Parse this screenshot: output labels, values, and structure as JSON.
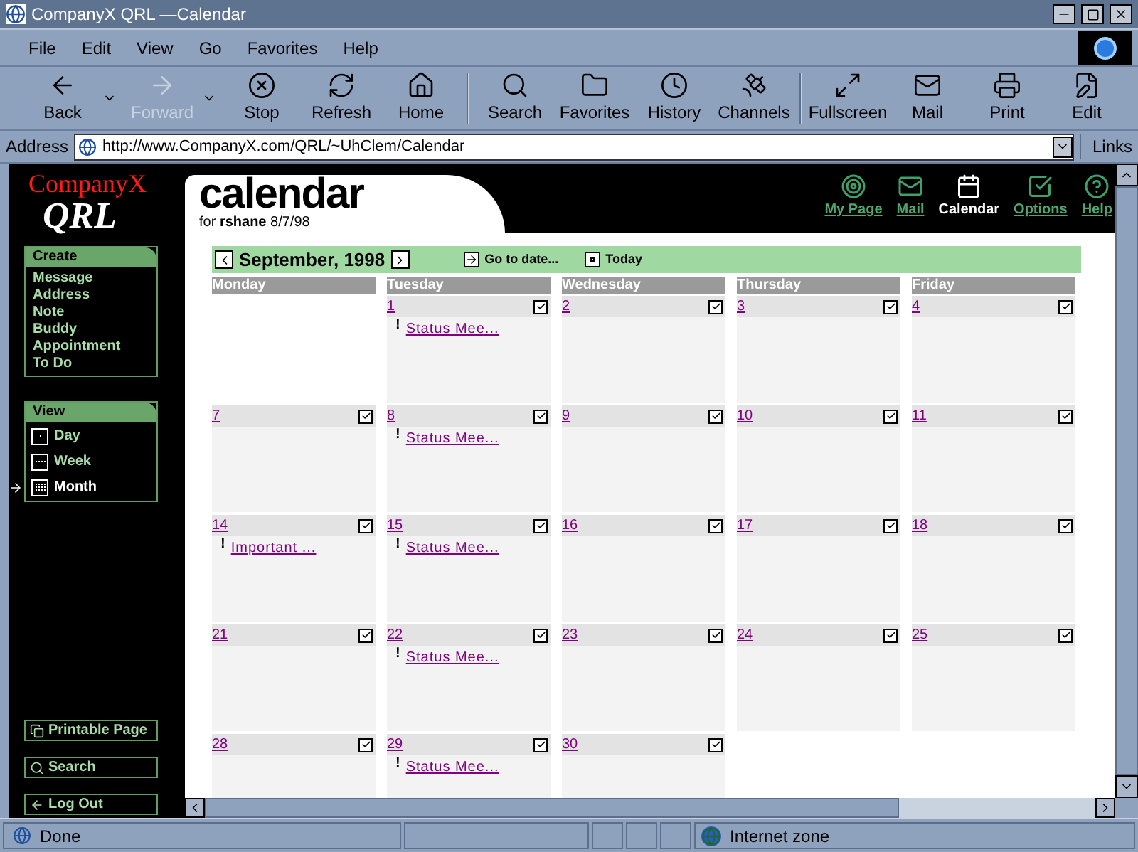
{
  "window": {
    "title": "CompanyX QRL —Calendar"
  },
  "menu": [
    "File",
    "Edit",
    "View",
    "Go",
    "Favorites",
    "Help"
  ],
  "toolbar": [
    {
      "kind": "back",
      "label": "Back",
      "disabled": false,
      "dropdown": true
    },
    {
      "kind": "forward",
      "label": "Forward",
      "disabled": true,
      "dropdown": true
    },
    {
      "kind": "stop",
      "label": "Stop",
      "disabled": false
    },
    {
      "kind": "refresh",
      "label": "Refresh",
      "disabled": false
    },
    {
      "kind": "home",
      "label": "Home",
      "disabled": false
    },
    {
      "kind": "search",
      "label": "Search",
      "disabled": false
    },
    {
      "kind": "favorites",
      "label": "Favorites",
      "disabled": false
    },
    {
      "kind": "history",
      "label": "History",
      "disabled": false
    },
    {
      "kind": "channels",
      "label": "Channels",
      "disabled": false
    },
    {
      "kind": "fullscreen",
      "label": "Fullscreen",
      "disabled": false
    },
    {
      "kind": "mail",
      "label": "Mail",
      "disabled": false
    },
    {
      "kind": "print",
      "label": "Print",
      "disabled": false
    },
    {
      "kind": "edit",
      "label": "Edit",
      "disabled": false
    }
  ],
  "address_bar": {
    "label": "Address",
    "url": "http://www.CompanyX.com/QRL/~UhClem/Calendar",
    "links": "Links"
  },
  "sidebar": {
    "logo": {
      "company": "CompanyX",
      "product": "QRL"
    },
    "create": {
      "title": "Create",
      "items": [
        "Message",
        "Address",
        "Note",
        "Buddy",
        "Appointment",
        "To Do"
      ]
    },
    "view": {
      "title": "View",
      "items": [
        {
          "kind": "day",
          "label": "Day",
          "selected": false
        },
        {
          "kind": "week",
          "label": "Week",
          "selected": false
        },
        {
          "kind": "month",
          "label": "Month",
          "selected": true
        }
      ]
    },
    "buttons": [
      {
        "kind": "print",
        "label": "Printable Page"
      },
      {
        "kind": "search",
        "label": "Search"
      },
      {
        "kind": "logout",
        "label": "Log Out"
      }
    ]
  },
  "header": {
    "title": "calendar",
    "subtitle": "for **rshane** 8/7/98",
    "nav": [
      {
        "kind": "mypage",
        "label": "My Page",
        "selected": false
      },
      {
        "kind": "mail",
        "label": "Mail",
        "selected": false
      },
      {
        "kind": "calendar",
        "label": "Calendar",
        "selected": true
      },
      {
        "kind": "options",
        "label": "Options",
        "selected": false
      },
      {
        "kind": "help",
        "label": "Help",
        "selected": false
      }
    ]
  },
  "calendar": {
    "month": "September, 1998",
    "go_to_date": "Go to date...",
    "today": "Today",
    "days": [
      "Monday",
      "Tuesday",
      "Wednesday",
      "Thursday",
      "Friday"
    ],
    "weeks": [
      [
        {
          "kind": "blank"
        },
        {
          "kind": "day",
          "day": "1",
          "events": [
            {
              "mark": "!",
              "text": "Status Mee..."
            }
          ]
        },
        {
          "kind": "day",
          "day": "2"
        },
        {
          "kind": "day",
          "day": "3"
        },
        {
          "kind": "day",
          "day": "4"
        }
      ],
      [
        {
          "kind": "day",
          "day": "7"
        },
        {
          "kind": "day",
          "day": "8",
          "events": [
            {
              "mark": "!",
              "text": "Status Mee..."
            }
          ]
        },
        {
          "kind": "day",
          "day": "9"
        },
        {
          "kind": "day",
          "day": "10"
        },
        {
          "kind": "day",
          "day": "11"
        }
      ],
      [
        {
          "kind": "day",
          "day": "14",
          "events": [
            {
              "mark": "!",
              "text": "Important ..."
            }
          ]
        },
        {
          "kind": "day",
          "day": "15",
          "events": [
            {
              "mark": "!",
              "text": "Status Mee..."
            }
          ]
        },
        {
          "kind": "day",
          "day": "16"
        },
        {
          "kind": "day",
          "day": "17"
        },
        {
          "kind": "day",
          "day": "18"
        }
      ],
      [
        {
          "kind": "day",
          "day": "21"
        },
        {
          "kind": "day",
          "day": "22",
          "events": [
            {
              "mark": "!",
              "text": "Status Mee..."
            }
          ]
        },
        {
          "kind": "day",
          "day": "23"
        },
        {
          "kind": "day",
          "day": "24"
        },
        {
          "kind": "day",
          "day": "25"
        }
      ],
      [
        {
          "kind": "day",
          "day": "28"
        },
        {
          "kind": "day",
          "day": "29",
          "events": [
            {
              "mark": "!",
              "text": "Status Mee..."
            }
          ]
        },
        {
          "kind": "day",
          "day": "30"
        },
        {
          "kind": "blank"
        },
        {
          "kind": "blank"
        }
      ]
    ]
  },
  "status_bar": {
    "text": "Done",
    "zone": "Internet zone"
  }
}
